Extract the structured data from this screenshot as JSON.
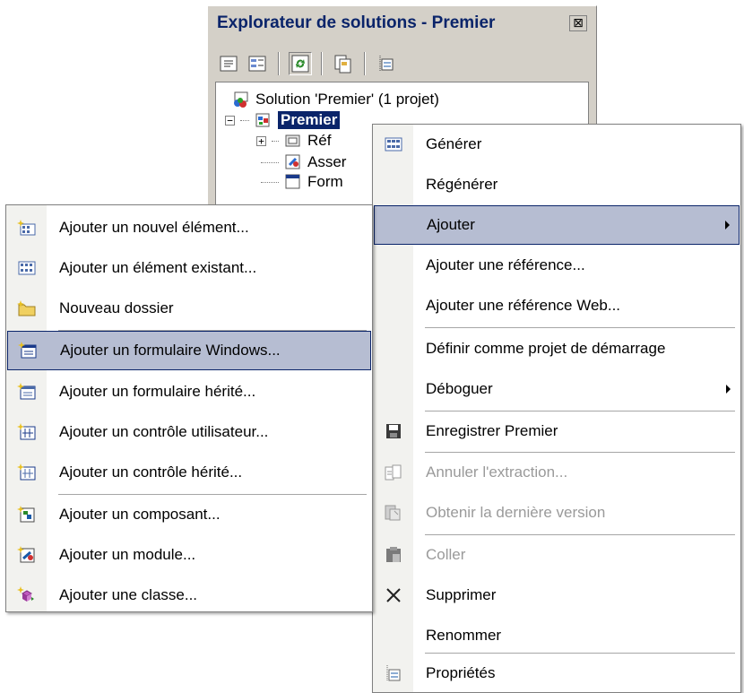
{
  "explorer": {
    "title": "Explorateur de solutions - Premier",
    "close_glyph": "⊠",
    "toolbar": [
      "properties-icon",
      "show-all-files-icon",
      "refresh-icon",
      "view-code-icon",
      "view-designer-icon"
    ],
    "tree": {
      "solution": "Solution 'Premier' (1 projet)",
      "project": "Premier",
      "children": [
        "Réf",
        "Asser",
        "Form"
      ]
    }
  },
  "context_menu": {
    "items": [
      {
        "label": "Générer",
        "icon": "build-icon"
      },
      {
        "label": "Régénérer"
      },
      {
        "label": "Ajouter",
        "submenu": true,
        "highlighted": true
      },
      {
        "label": "Ajouter une référence..."
      },
      {
        "label": "Ajouter une référence Web..."
      },
      {
        "label": "Définir comme projet de démarrage"
      },
      {
        "label": "Déboguer",
        "submenu": true
      },
      {
        "label": "Enregistrer Premier",
        "icon": "save-icon"
      },
      {
        "label": "Annuler l'extraction...",
        "icon": "undo-checkout-icon",
        "disabled": true
      },
      {
        "label": "Obtenir la dernière version",
        "icon": "get-latest-icon",
        "disabled": true
      },
      {
        "label": "Coller",
        "icon": "paste-icon",
        "disabled": true
      },
      {
        "label": "Supprimer",
        "icon": "delete-icon"
      },
      {
        "label": "Renommer"
      },
      {
        "label": "Propriétés",
        "icon": "properties-icon"
      }
    ]
  },
  "add_submenu": {
    "items": [
      {
        "label": "Ajouter un nouvel élément...",
        "icon": "new-item-icon"
      },
      {
        "label": "Ajouter un élément existant...",
        "icon": "existing-item-icon"
      },
      {
        "label": "Nouveau dossier",
        "icon": "new-folder-icon"
      },
      {
        "label": "Ajouter un formulaire Windows...",
        "icon": "windows-form-icon",
        "highlighted": true
      },
      {
        "label": "Ajouter un formulaire hérité...",
        "icon": "inherited-form-icon"
      },
      {
        "label": "Ajouter un contrôle utilisateur...",
        "icon": "user-control-icon"
      },
      {
        "label": "Ajouter un contrôle hérité...",
        "icon": "inherited-control-icon"
      },
      {
        "label": "Ajouter un composant...",
        "icon": "component-icon"
      },
      {
        "label": "Ajouter un module...",
        "icon": "module-icon"
      },
      {
        "label": "Ajouter une classe...",
        "icon": "class-icon"
      }
    ]
  },
  "colors": {
    "highlight_bg": "#b6bdd2",
    "highlight_border": "#0a246a",
    "title_text": "#0a246a",
    "disabled_text": "#9a9a9a",
    "selected_node_bg": "#0a246a"
  }
}
